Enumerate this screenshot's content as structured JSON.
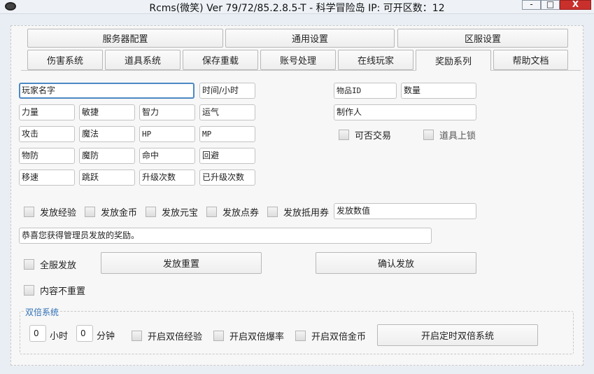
{
  "window": {
    "title": "Rcms(微笑) Ver 79/72/85.2.8.5-T - 科学冒险岛 IP:  可开区数：12",
    "min": "-",
    "max": "□",
    "close": "X"
  },
  "top_tabs": [
    "服务器配置",
    "通用设置",
    "区服设置"
  ],
  "tabs": [
    "伤害系统",
    "道具系统",
    "保存重载",
    "账号处理",
    "在线玩家",
    "奖励系列",
    "帮助文档"
  ],
  "active_tab": "奖励系列",
  "fields": {
    "player_name": "玩家名字",
    "time_hour": "时间/小时",
    "item_id": "物品ID",
    "quantity": "数量",
    "str": "力量",
    "dex": "敏捷",
    "int": "智力",
    "luk": "运气",
    "creator": "制作人",
    "atk": "攻击",
    "matk": "魔法",
    "hp": "HP",
    "mp": "MP",
    "pdef": "物防",
    "mdef": "魔防",
    "acc": "命中",
    "avoid": "回避",
    "speed": "移速",
    "jump": "跳跃",
    "upgrade_count": "升级次数",
    "upgraded_count": "已升级次数",
    "send_value": "发放数值",
    "message": "恭喜您获得管理员发放的奖励。"
  },
  "checkboxes": {
    "tradeable": "可否交易",
    "lock_item": "道具上锁",
    "send_exp": "发放经验",
    "send_meso": "发放金币",
    "send_cash": "发放元宝",
    "send_points": "发放点券",
    "send_voucher": "发放抵用券",
    "server_wide": "全服发放",
    "no_reset": "内容不重置"
  },
  "buttons": {
    "reset": "发放重置",
    "confirm": "确认发放",
    "timed_double": "开启定时双倍系统"
  },
  "double_system": {
    "title": "双倍系统",
    "hours_value": "0",
    "hours_label": "小时",
    "minutes_value": "0",
    "minutes_label": "分钟",
    "double_exp": "开启双倍经验",
    "double_drop": "开启双倍爆率",
    "double_meso": "开启双倍金币"
  }
}
